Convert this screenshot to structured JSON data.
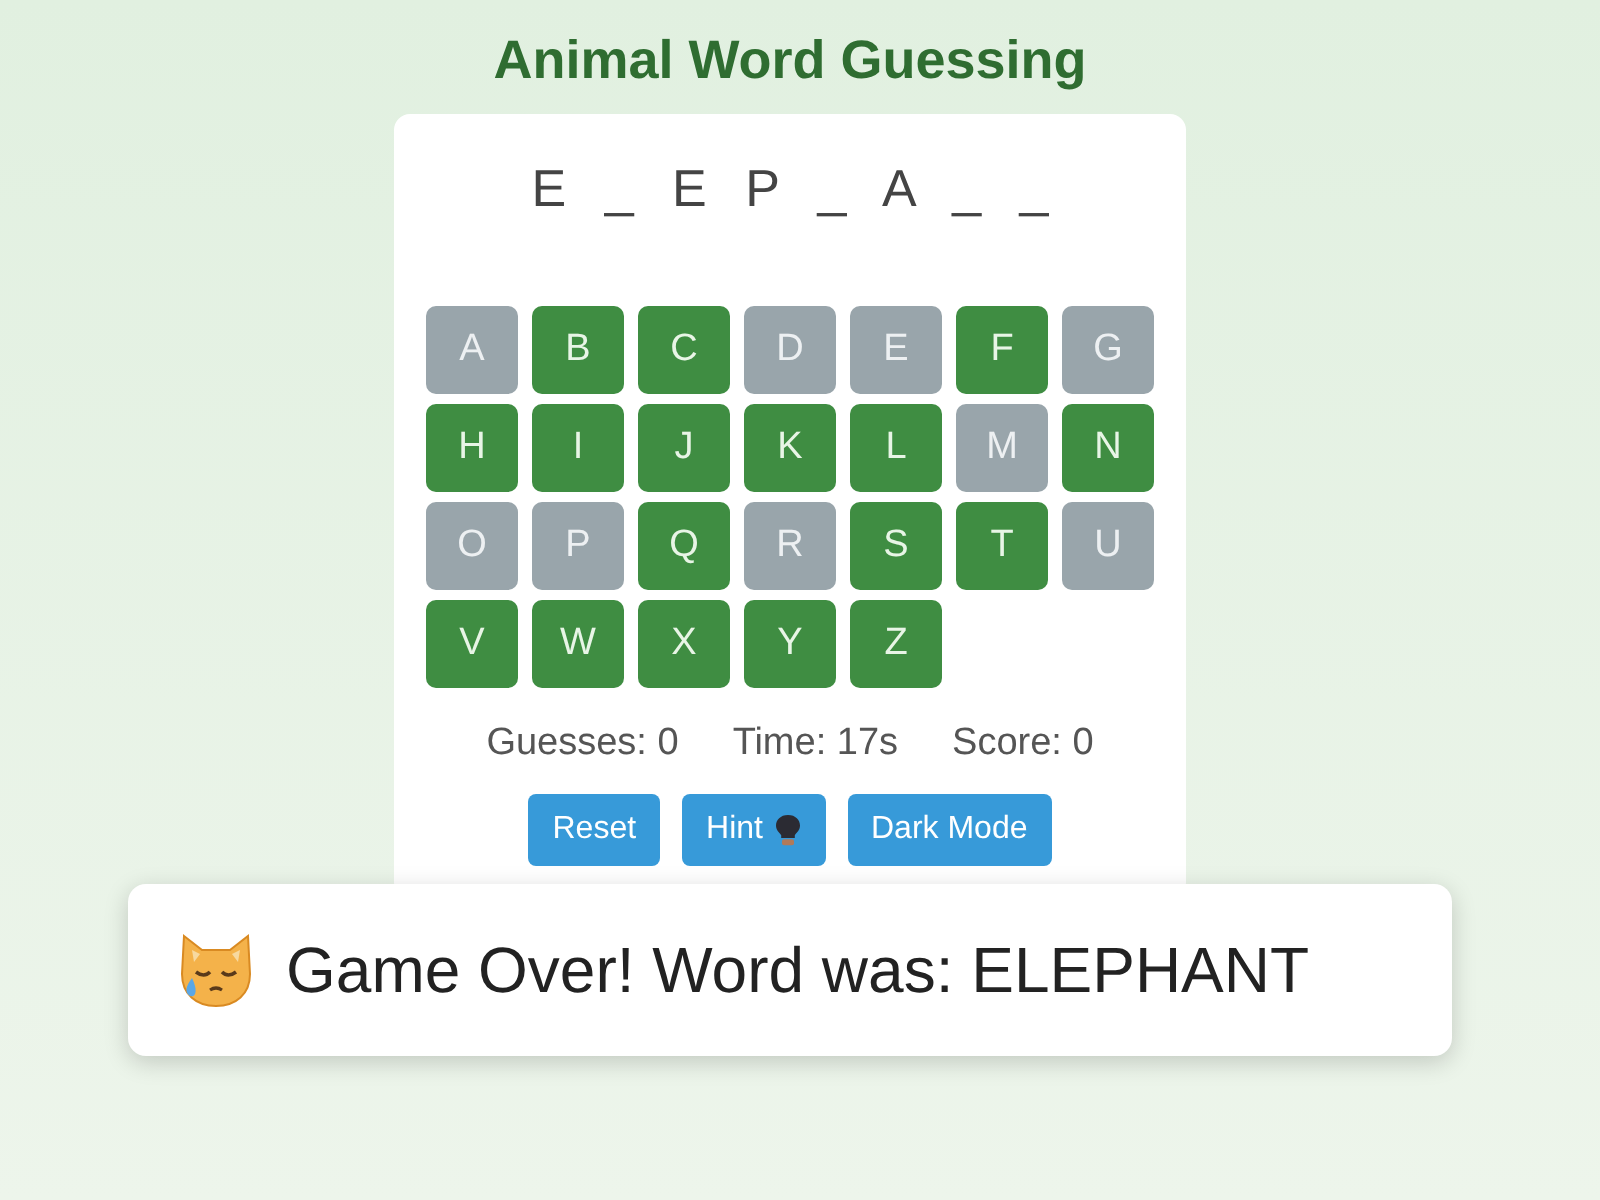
{
  "title": "Animal Word Guessing",
  "word": "E _ E P _ A _ _",
  "letters": [
    {
      "letter": "A",
      "disabled": true
    },
    {
      "letter": "B",
      "disabled": false
    },
    {
      "letter": "C",
      "disabled": false
    },
    {
      "letter": "D",
      "disabled": true
    },
    {
      "letter": "E",
      "disabled": true
    },
    {
      "letter": "F",
      "disabled": false
    },
    {
      "letter": "G",
      "disabled": true
    },
    {
      "letter": "H",
      "disabled": false
    },
    {
      "letter": "I",
      "disabled": false
    },
    {
      "letter": "J",
      "disabled": false
    },
    {
      "letter": "K",
      "disabled": false
    },
    {
      "letter": "L",
      "disabled": false
    },
    {
      "letter": "M",
      "disabled": true
    },
    {
      "letter": "N",
      "disabled": false
    },
    {
      "letter": "O",
      "disabled": true
    },
    {
      "letter": "P",
      "disabled": true
    },
    {
      "letter": "Q",
      "disabled": false
    },
    {
      "letter": "R",
      "disabled": true
    },
    {
      "letter": "S",
      "disabled": false
    },
    {
      "letter": "T",
      "disabled": false
    },
    {
      "letter": "U",
      "disabled": true
    },
    {
      "letter": "V",
      "disabled": false
    },
    {
      "letter": "W",
      "disabled": false
    },
    {
      "letter": "X",
      "disabled": false
    },
    {
      "letter": "Y",
      "disabled": false
    },
    {
      "letter": "Z",
      "disabled": false
    }
  ],
  "stats": [
    "Guesses: 0",
    "Time: 17s",
    "Score: 0"
  ],
  "buttons": [
    {
      "label": "Reset",
      "kind": "plain"
    },
    {
      "label": "Hint",
      "kind": "hint"
    },
    {
      "label": "Dark Mode",
      "kind": "plain"
    }
  ],
  "toast": {
    "message": "Game Over! Word was: ELEPHANT"
  }
}
